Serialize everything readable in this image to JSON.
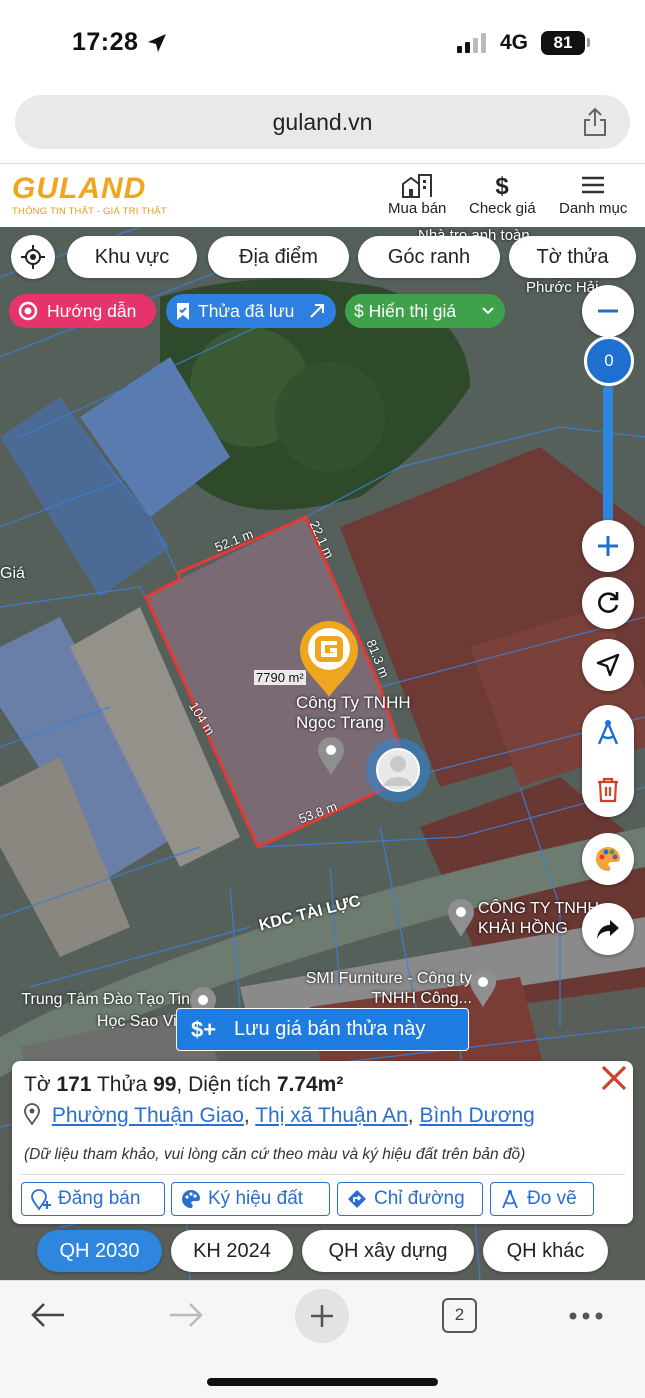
{
  "status": {
    "time": "17:28",
    "network": "4G",
    "battery": "81"
  },
  "browser": {
    "url": "guland.vn",
    "tab_count": "2"
  },
  "header": {
    "logo": "GULAND",
    "tagline": "THÔNG TIN THẬT - GIÁ TRỊ THẬT",
    "nav": [
      {
        "label": "Mua bán",
        "icon": "buildings-icon"
      },
      {
        "label": "Check giá",
        "icon": "dollar-icon"
      },
      {
        "label": "Danh mục",
        "icon": "menu-icon"
      }
    ]
  },
  "map": {
    "top_tabs": [
      "Khu vực",
      "Địa điểm",
      "Góc ranh",
      "Tờ thửa"
    ],
    "tags": [
      {
        "label": "Hướng dẫn",
        "color": "#e6336b"
      },
      {
        "label": "Thửa đã lưu",
        "color": "#2f7fe0"
      },
      {
        "label": "Hiển thị giá",
        "color": "#3fa24a"
      }
    ],
    "zoom_value": "0",
    "edge_labels": [
      "52.1 m",
      "22.1 m",
      "81.3 m",
      "104 m",
      "53.8 m"
    ],
    "area_label": "7790 m²",
    "place_labels": [
      "Công Ty TNHH Ngọc Trang",
      "KDC TÀI LỰC",
      "CÔNG TY TNHH KHẢI HỒNG",
      "SMI Furniture - Công ty TNHH Công...",
      "Trung Tâm Đào Tạo Tin Học Sao Việt",
      "Công ty TNHH Phước Hải",
      "Nhà trọ anh toàn",
      "Giá"
    ],
    "save_button": "Lưu giá bán thửa này",
    "save_button_icon": "$+"
  },
  "parcel": {
    "to_label": "Tờ",
    "to": "171",
    "thua_label": "Thửa",
    "thua": "99",
    "area_label": "Diện tích",
    "area": "7.74m²",
    "ward": "Phường Thuận Giao",
    "town": "Thị xã Thuận An",
    "province": "Bình Dương",
    "note": "(Dữ liệu tham khảo, vui lòng căn cứ theo màu và ký hiệu đất trên bản đồ)",
    "actions": [
      "Đăng bán",
      "Ký hiệu đất",
      "Chỉ đường",
      "Đo vẽ"
    ]
  },
  "plan_tabs": [
    "QH 2030",
    "KH 2024",
    "QH xây dựng",
    "QH khác"
  ],
  "colors": {
    "accent": "#2e86de",
    "logo": "#f0a51e",
    "parcel_line": "#e53935",
    "close": "#d0402b"
  }
}
